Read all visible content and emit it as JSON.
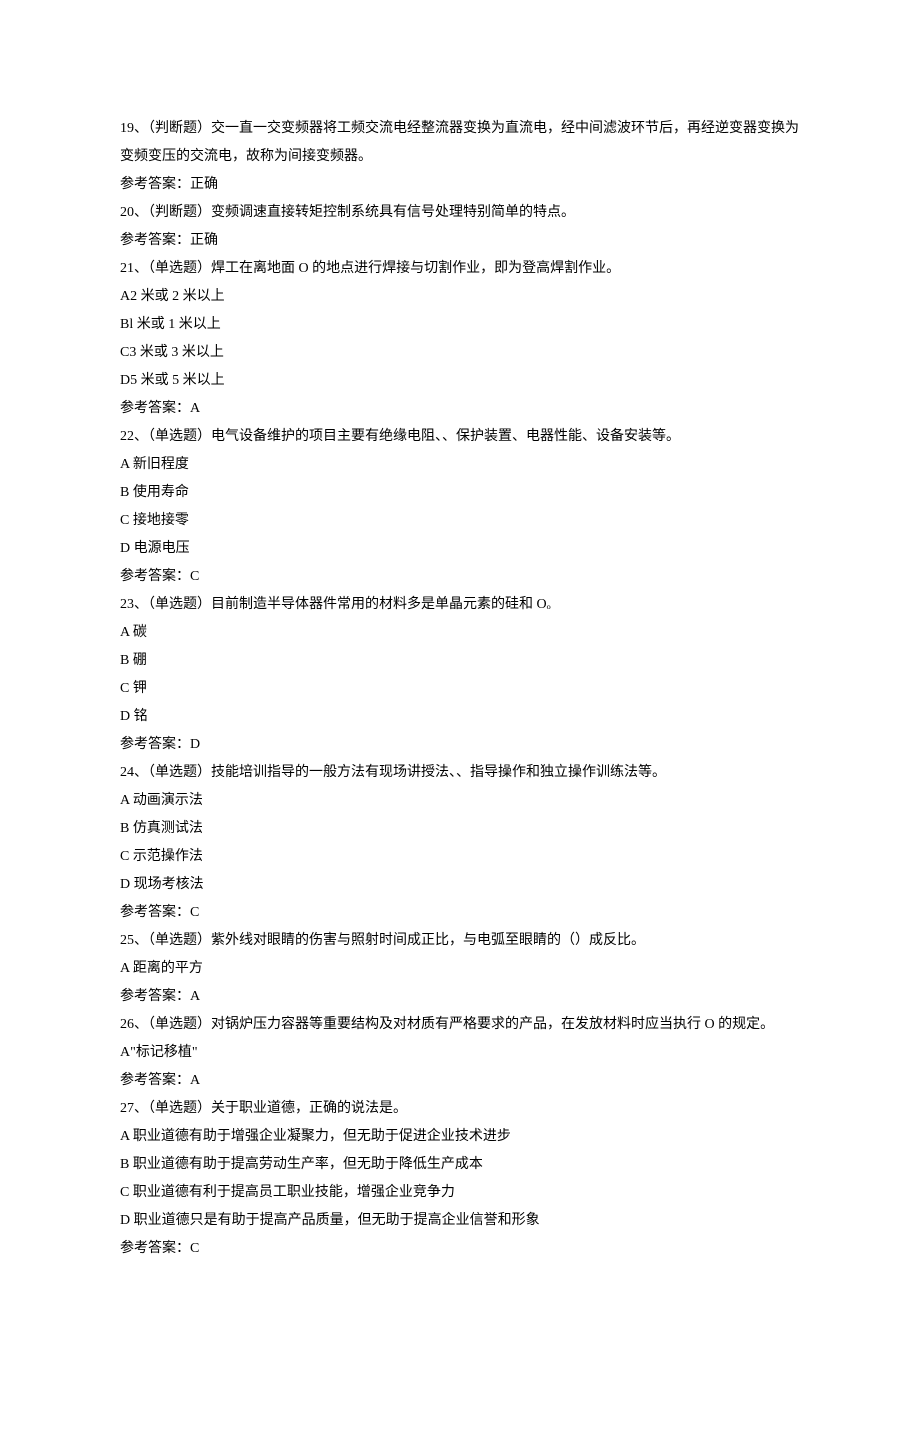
{
  "questions": [
    {
      "num": "19、",
      "type": "（判断题）",
      "text": "交一直一交变频器将工频交流电经整流器变换为直流电，经中间滤波环节后，再经逆变器变换为变频变压的交流电，故称为间接变频器。",
      "answer": "参考答案：正确"
    },
    {
      "num": "20、",
      "type": "（判断题）",
      "text": "变频调速直接转矩控制系统具有信号处理特别简单的特点。",
      "answer": "参考答案：正确"
    },
    {
      "num": "21、",
      "type": "（单选题）",
      "text": "焊工在离地面 O 的地点进行焊接与切割作业，即为登高焊割作业。",
      "options": [
        "A2 米或 2 米以上",
        "Bl 米或 1 米以上",
        "C3 米或 3 米以上",
        "D5 米或 5 米以上"
      ],
      "answer": "参考答案：A"
    },
    {
      "num": "22、",
      "type": "（单选题）",
      "text": "电气设备维护的项目主要有绝缘电阻、、保护装置、电器性能、设备安装等。",
      "options": [
        "A 新旧程度",
        "B 使用寿命",
        "C 接地接零",
        "D 电源电压"
      ],
      "answer": "参考答案：C"
    },
    {
      "num": "23、",
      "type": "（单选题）",
      "text": "目前制造半导体器件常用的材料多是单晶元素的硅和 Oₒ",
      "options": [
        "A 碳",
        "B 硼",
        "C 钾",
        "D 铭"
      ],
      "answer": "参考答案：D"
    },
    {
      "num": "24、",
      "type": "（单选题）",
      "text": "技能培训指导的一般方法有现场讲授法、、指导操作和独立操作训练法等。",
      "options": [
        "A 动画演示法",
        "B 仿真测试法",
        "C 示范操作法",
        "D 现场考核法"
      ],
      "answer": "参考答案：C"
    },
    {
      "num": "25、",
      "type": "（单选题）",
      "text": "紫外线对眼睛的伤害与照射时间成正比，与电弧至眼睛的（）成反比。",
      "options": [
        "A 距离的平方"
      ],
      "answer": "参考答案：A"
    },
    {
      "num": "26、",
      "type": "（单选题）",
      "text": "对锅炉压力容器等重要结构及对材质有严格要求的产品，在发放材料时应当执行 O 的规定。",
      "options": [
        "A\"标记移植\""
      ],
      "answer": "参考答案：A"
    },
    {
      "num": "27、",
      "type": "（单选题）",
      "text": "关于职业道德，正确的说法是。",
      "options": [
        "A 职业道德有助于增强企业凝聚力，但无助于促进企业技术进步",
        "B 职业道德有助于提高劳动生产率，但无助于降低生产成本",
        "C 职业道德有利于提高员工职业技能，增强企业竞争力",
        "D 职业道德只是有助于提高产品质量，但无助于提高企业信誉和形象"
      ],
      "answer": "参考答案：C"
    }
  ]
}
